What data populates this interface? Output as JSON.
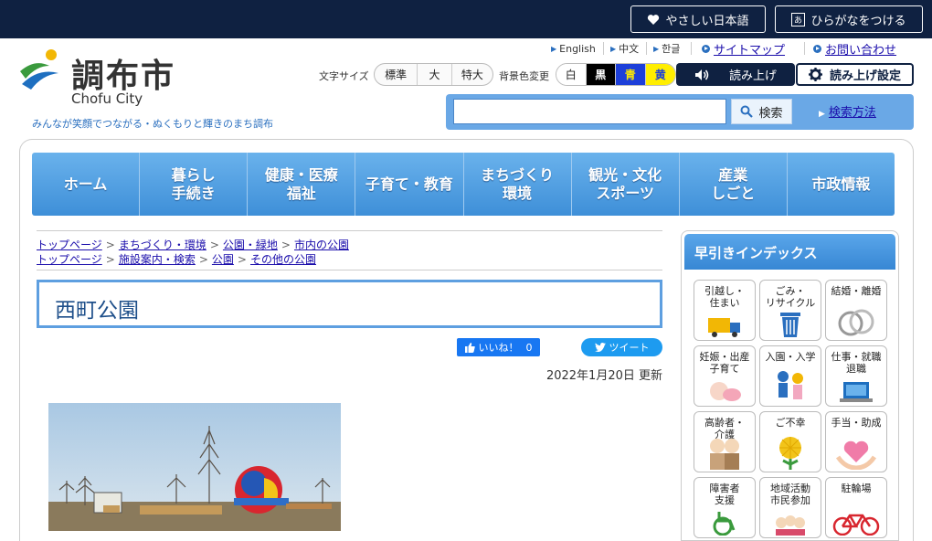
{
  "topbar": {
    "easy_japanese": "やさしい日本語",
    "furigana": "ひらがなをつける"
  },
  "logo": {
    "jp": "調布市",
    "en": "Chofu City"
  },
  "catchphrase": "みんなが笑顔でつながる・ぬくもりと輝きのまち調布",
  "languages": [
    "English",
    "中文",
    "한글"
  ],
  "links": {
    "sitemap": "サイトマップ",
    "contact": "お問い合わせ"
  },
  "font_size": {
    "label": "文字サイズ",
    "options": [
      "標準",
      "大",
      "特大"
    ]
  },
  "bg_color": {
    "label": "背景色変更",
    "options": [
      "白",
      "黒",
      "青",
      "黄"
    ]
  },
  "read_aloud": "読み上げ",
  "read_settings": "読み上げ設定",
  "search": {
    "button": "検索",
    "howto": "検索方法",
    "placeholder": ""
  },
  "nav": [
    "ホーム",
    "暮らし\n手続き",
    "健康・医療\n福祉",
    "子育て・教育",
    "まちづくり\n環境",
    "観光・文化\nスポーツ",
    "産業\nしごと",
    "市政情報"
  ],
  "breadcrumbs": [
    [
      "トップページ",
      "まちづくり・環境",
      "公園・緑地",
      "市内の公園"
    ],
    [
      "トップページ",
      "施設案内・検索",
      "公園",
      "その他の公園"
    ]
  ],
  "page_title": "西町公園",
  "social": {
    "like": "いいね！",
    "like_count": "0",
    "tweet": "ツイート"
  },
  "updated": "2022年1月20日 更新",
  "sidebar": {
    "title": "早引きインデックス",
    "tiles": [
      "引越し・\n住まい",
      "ごみ・\nリサイクル",
      "結婚・離婚",
      "妊娠・出産\n子育て",
      "入園・入学",
      "仕事・就職\n退職",
      "高齢者・\n介護",
      "ご不幸",
      "手当・助成",
      "障害者\n支援",
      "地域活動\n市民参加",
      "駐輪場"
    ]
  },
  "colors": {
    "topbar": "#0f2141",
    "accent": "#3e8fd8",
    "link": "#1a0dab"
  }
}
